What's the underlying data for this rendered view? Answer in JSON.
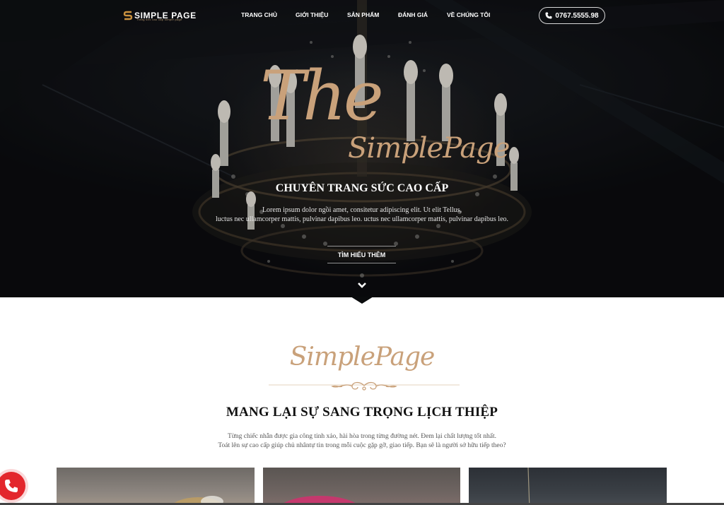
{
  "header": {
    "logo_text": "SIMPLE PAGE",
    "logo_sub": "Trang sức cao cấp simple page",
    "nav": [
      "TRANG CHỦ",
      "GIỚI THIỆU",
      "SẢN PHẨM",
      "ĐÁNH GIÁ",
      "VỀ CHÚNG TÔI"
    ],
    "phone": "0767.5555.98"
  },
  "hero": {
    "script_title": "The",
    "script_subtitle": "SimplePage",
    "heading": "CHUYÊN TRANG SỨC CAO CẤP",
    "line1": "Lorem ipsum dolor ngồi amet, consitetur adipiscing elit. Ut elit Tellus,",
    "line2": "luctus nec ullamcorper mattis, pulvinar dapibus leo. uctus nec ullamcorper mattis, pulvinar dapibus leo.",
    "cta": "TÌM HIỂU THÊM"
  },
  "intro": {
    "script": "SimplePage",
    "heading": "MANG LẠI SỰ SANG TRỌNG LỊCH THIỆP",
    "text1": "Từng chiếc nhẫn được gia công tinh xảo, hài hòa trong từng đường nét. Đem lại chất lượng tốt nhất.",
    "text2": "Toát lên sự cao cấp giúp chủ nhântự tin trong mỗi cuộc gặp gỡ, giao tiếp. Bạn sẽ là người sở hữu tiếp theo?"
  },
  "colors": {
    "accent_gold": "#c9a17a",
    "call_red": "#e3262c"
  },
  "icons": {
    "phone": "phone-icon",
    "down": "chevron-down-icon",
    "call": "phone-call-icon"
  }
}
